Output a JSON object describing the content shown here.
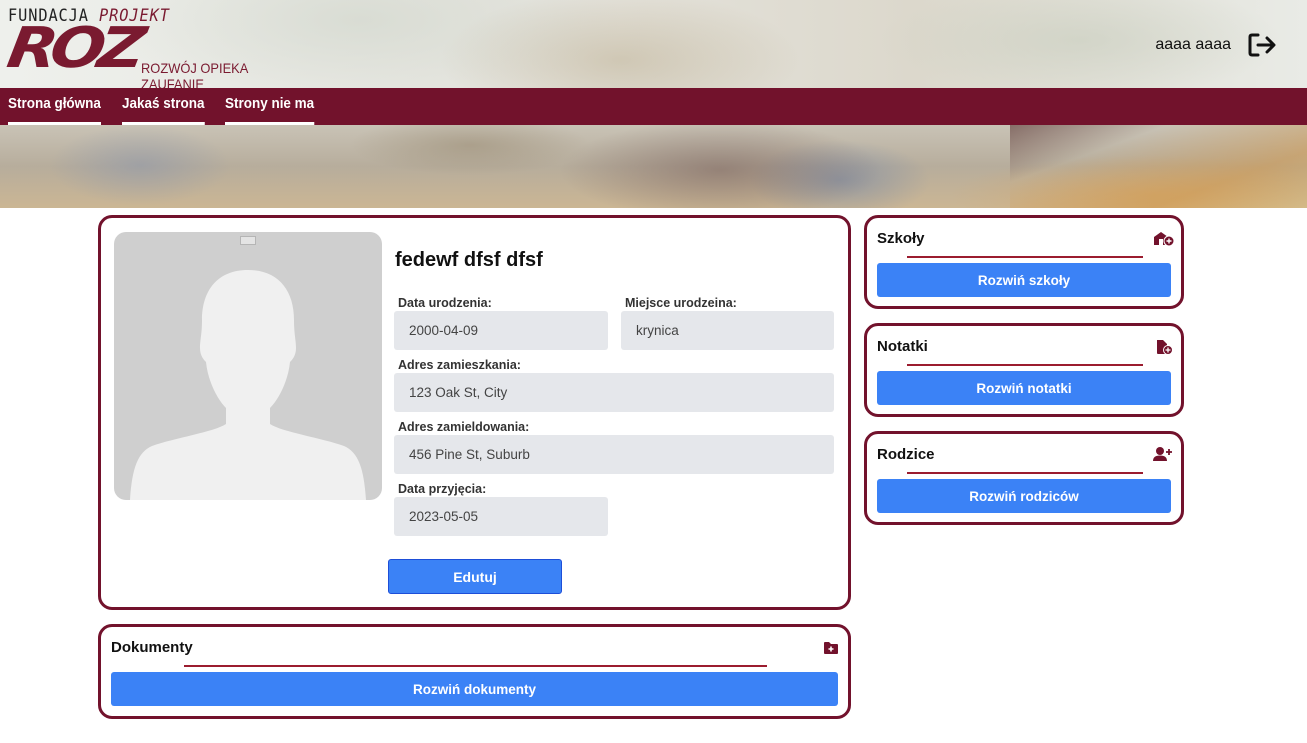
{
  "logo": {
    "line1_a": "FUNDACJA",
    "line1_b": "PROJEKT",
    "mark": "ROZ",
    "tagline": "ROZWÓJ OPIEKA ZAUFANIE"
  },
  "user": {
    "name": "aaaa aaaa",
    "logout_icon": "logout-icon"
  },
  "nav": {
    "items": [
      {
        "label": "Strona główna"
      },
      {
        "label": "Jakaś strona"
      },
      {
        "label": "Strony nie ma"
      }
    ]
  },
  "profile": {
    "name": "fedewf dfsf dfsf",
    "avatar_icon": "person-silhouette",
    "fields": {
      "birth_date": {
        "label": "Data urodzenia:",
        "value": "2000-04-09"
      },
      "birth_place": {
        "label": "Miejsce urodzeina:",
        "value": "krynica"
      },
      "address": {
        "label": "Adres zamieszkania:",
        "value": "123 Oak St, City"
      },
      "registered_address": {
        "label": "Adres zamieldowania:",
        "value": "456 Pine St, Suburb"
      },
      "admission_date": {
        "label": "Data przyjęcia:",
        "value": "2023-05-05"
      }
    },
    "edit_label": "Edutuj"
  },
  "documents": {
    "title": "Dokumenty",
    "icon": "folder-plus-icon",
    "button_label": "Rozwiń dokumenty"
  },
  "schools": {
    "title": "Szkoły",
    "icon": "school-plus-icon",
    "button_label": "Rozwiń szkoły"
  },
  "notes": {
    "title": "Notatki",
    "icon": "file-plus-icon",
    "button_label": "Rozwiń notatki"
  },
  "parents": {
    "title": "Rodzice",
    "icon": "user-plus-icon",
    "button_label": "Rozwiń rodziców"
  },
  "colors": {
    "brand": "#72122c",
    "accent_line": "#9b1c2f",
    "button": "#3b82f6",
    "field_bg": "#e5e7eb"
  }
}
